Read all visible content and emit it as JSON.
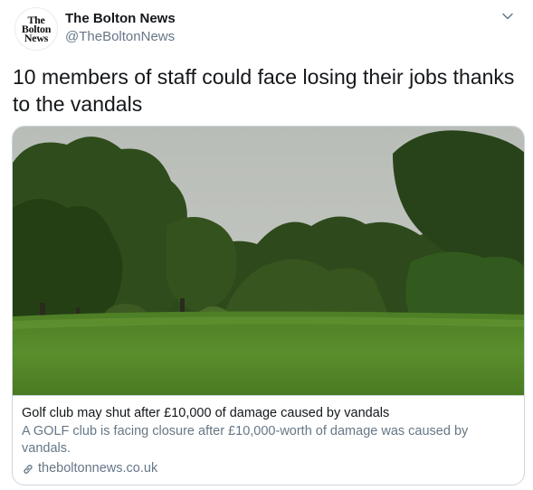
{
  "author": {
    "avatar_text": [
      "The",
      "Bolton",
      "News"
    ],
    "display_name": "The Bolton News",
    "handle": "@TheBoltonNews"
  },
  "tweet": {
    "text": "10 members of staff could face losing their jobs thanks to the vandals"
  },
  "card": {
    "image_icon": "golf-course-photo",
    "title": "Golf club may shut after £10,000 of damage caused by vandals",
    "description": "A GOLF club is facing closure after £10,000-worth of damage was caused by vandals.",
    "domain": "theboltonnews.co.uk",
    "domain_icon": "link-icon"
  },
  "icons": {
    "menu": "chevron-down-icon"
  },
  "colors": {
    "text_primary": "#14171a",
    "text_secondary": "#657786",
    "border": "#ccd6dd"
  }
}
